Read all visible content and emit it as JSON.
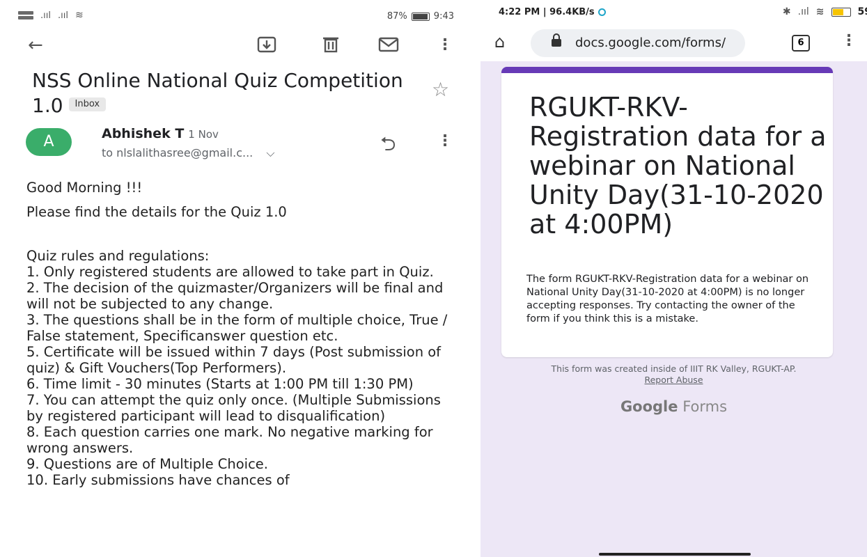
{
  "gmail": {
    "status": {
      "sim1": "VoLTE",
      "sim2": "VoLTE",
      "battery": "87%",
      "time": "9:43",
      "battery_level": 0.87
    },
    "subject": "NSS Online National Quiz Competition 1.0",
    "label": "Inbox",
    "avatar_letter": "A",
    "sender": "Abhishek T",
    "date": "1 Nov",
    "to": "to nlslalithasree@gmail.c...",
    "body_lines": [
      "Good Morning !!!",
      "Please find the details for the Quiz 1.0",
      "Quiz rules and regulations:",
      "1. Only registered students are allowed to take part in Quiz.",
      "2. The decision of the quizmaster/Organizers will be final and will not be subjected to any change.",
      "3. The questions shall be in the form of multiple choice, True / False statement, Specificanswer question etc.",
      "5. Certificate will be issued within 7 days (Post submission of quiz) & Gift Vouchers(Top Performers).",
      "6. Time limit - 30 minutes (Starts at 1:00 PM till 1:30 PM)",
      "7. You can attempt the quiz only once. (Multiple Submissions by registered participant will lead to disqualification)",
      "8. Each question carries one mark. No negative marking for wrong answers.",
      "9. Questions are of Multiple Choice.",
      "10. Early submissions have chances of"
    ]
  },
  "forms": {
    "status": {
      "time_speed": "4:22 PM | 96.4KB/s",
      "battery": "59",
      "battery_level": 0.59
    },
    "url": "docs.google.com/forms/",
    "tab_count": "6",
    "title": "RGUKT-RKV-Registration data for a webinar on National Unity Day(31-10-2020 at 4:00PM)",
    "description": "The form RGUKT-RKV-Registration data for a webinar on National Unity Day(31-10-2020 at 4:00PM) is no longer accepting responses. Try contacting the owner of the form if you think this is a mistake.",
    "footer_text": "This form was created inside of IIIT RK Valley, RGUKT-AP.",
    "report_link": "Report Abuse",
    "brand_google": "Google",
    "brand_forms": "Forms",
    "accent_color": "#673ab7"
  }
}
